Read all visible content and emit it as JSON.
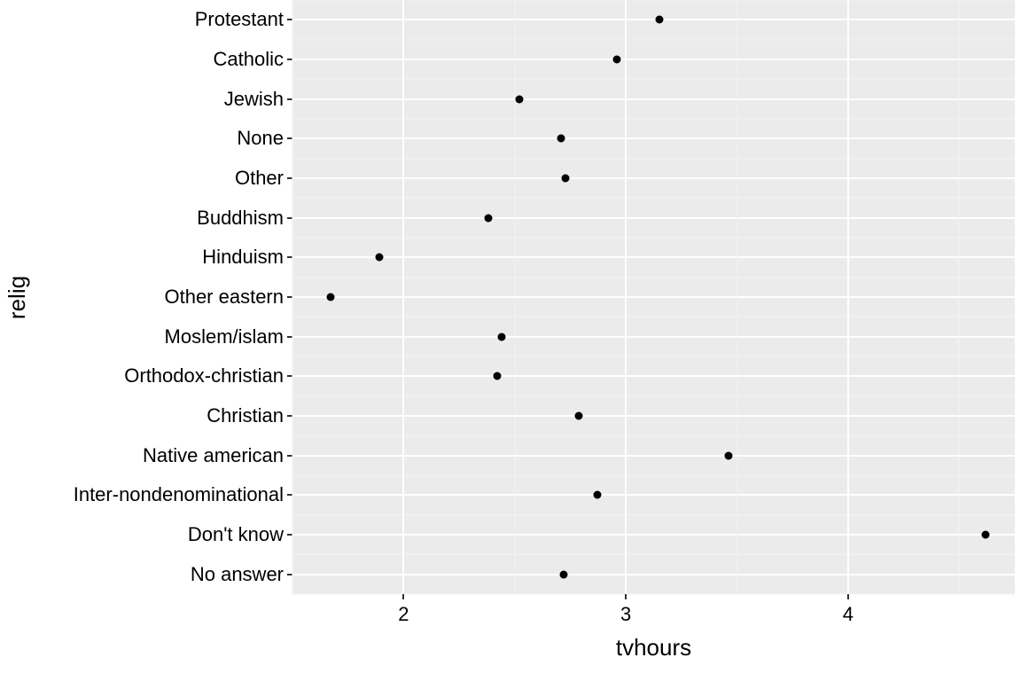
{
  "chart_data": {
    "type": "scatter",
    "xlabel": "tvhours",
    "ylabel": "relig",
    "xlim": [
      1.5,
      4.75
    ],
    "x_ticks_major": [
      2,
      3,
      4
    ],
    "x_ticks_minor": [
      1.5,
      2.5,
      3.5,
      4.5
    ],
    "categories": [
      "Protestant",
      "Catholic",
      "Jewish",
      "None",
      "Other",
      "Buddhism",
      "Hinduism",
      "Other eastern",
      "Moslem/islam",
      "Orthodox-christian",
      "Christian",
      "Native american",
      "Inter-nondenominational",
      "Don't know",
      "No answer"
    ],
    "values": [
      3.15,
      2.96,
      2.52,
      2.71,
      2.73,
      2.38,
      1.89,
      1.67,
      2.44,
      2.42,
      2.79,
      3.46,
      2.87,
      4.62,
      2.72
    ]
  }
}
